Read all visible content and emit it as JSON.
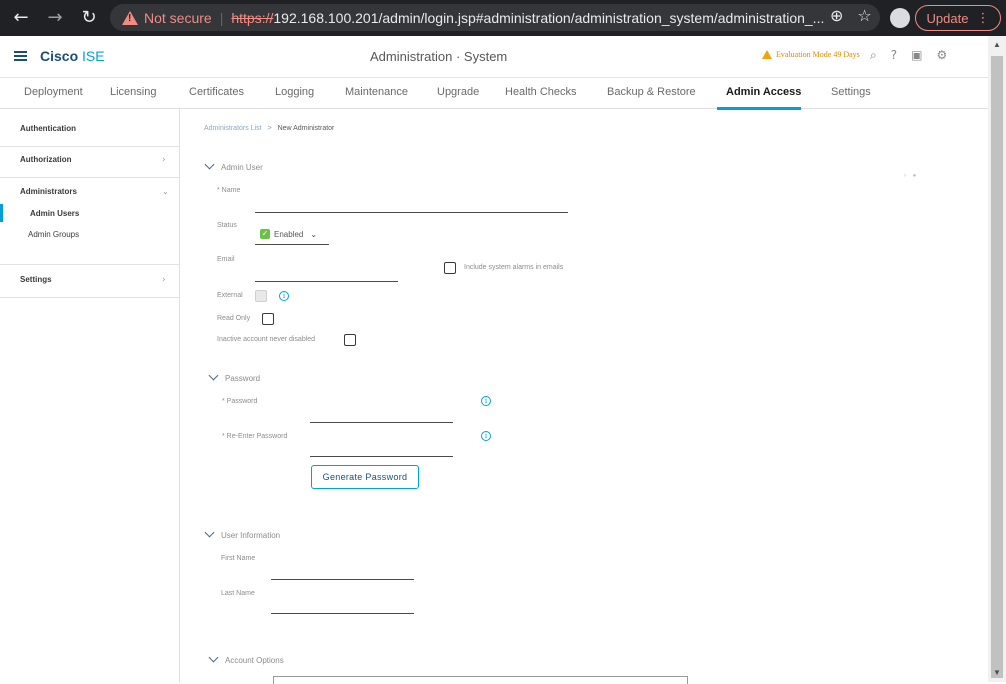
{
  "browser": {
    "not_secure_label": "Not secure",
    "separator": "|",
    "url_scheme": "https://",
    "url_rest": "192.168.100.201/admin/login.jsp#administration/administration_system/administration_...",
    "update_label": "Update",
    "icons": [
      "back-icon",
      "forward-icon",
      "reload-icon",
      "zoom-icon",
      "star-icon",
      "profile-icon",
      "menu-icon"
    ]
  },
  "header": {
    "brand_bold": "Cisco",
    "brand_light": " ISE",
    "title": "Administration · System",
    "eval_text": "Evaluation Mode 49 Days",
    "icons": [
      "search-icon",
      "help-icon",
      "dashboard-icon",
      "gear-icon"
    ]
  },
  "tabs": [
    {
      "label": "Deployment"
    },
    {
      "label": "Licensing"
    },
    {
      "label": "Certificates"
    },
    {
      "label": "Logging"
    },
    {
      "label": "Maintenance"
    },
    {
      "label": "Upgrade"
    },
    {
      "label": "Health Checks"
    },
    {
      "label": "Backup & Restore"
    },
    {
      "label": "Admin Access",
      "active": true
    },
    {
      "label": "Settings"
    }
  ],
  "sidebar": {
    "authentication": "Authentication",
    "authorization": "Authorization",
    "administrators": "Administrators",
    "admin_users": "Admin Users",
    "admin_groups": "Admin Groups",
    "settings": "Settings"
  },
  "breadcrumb": {
    "parent": "Administrators List",
    "separator": ">",
    "current": "New Administrator"
  },
  "admin_user": {
    "section": "Admin User",
    "name_label": "* Name",
    "name_value": "",
    "status_label": "Status",
    "status_value": "Enabled",
    "email_label": "Email",
    "email_value": "",
    "alarms_label": "Include system alarms in emails",
    "external_label": "External",
    "read_only_label": "Read Only",
    "inactive_label": "Inactive account never disabled"
  },
  "password": {
    "section": "Password",
    "password_label": "* Password",
    "reenter_label": "* Re-Enter Password",
    "generate_label": "Generate Password"
  },
  "user_info": {
    "section": "User Information",
    "first_name_label": "First Name",
    "last_name_label": "Last Name"
  },
  "account_options": {
    "section": "Account Options"
  }
}
